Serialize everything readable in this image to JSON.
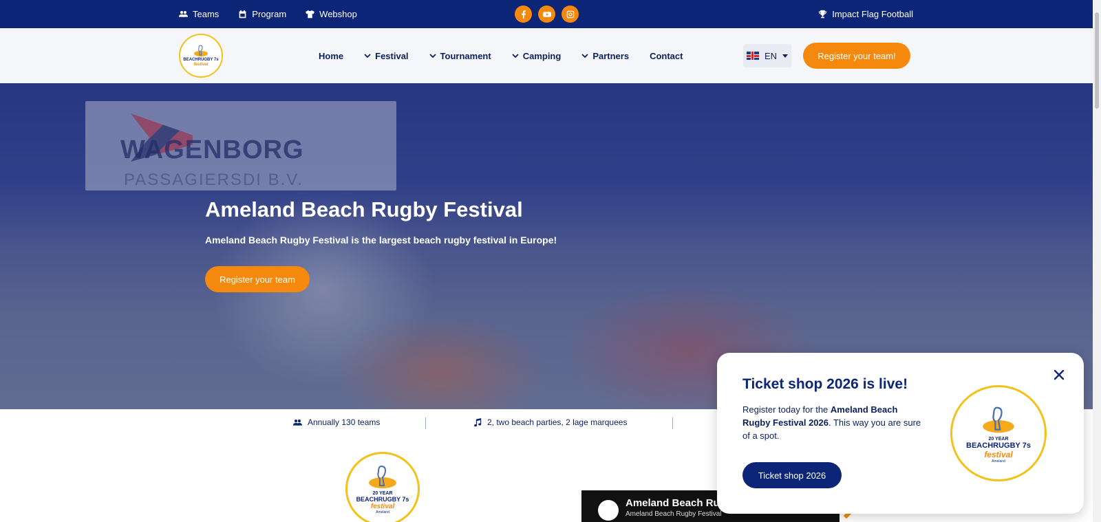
{
  "topbar": {
    "links": [
      {
        "label": "Teams",
        "icon": "users-icon"
      },
      {
        "label": "Program",
        "icon": "calendar-icon"
      },
      {
        "label": "Webshop",
        "icon": "tshirt-icon"
      }
    ],
    "socials": [
      "facebook-icon",
      "youtube-icon",
      "instagram-icon"
    ],
    "right_link": "Impact Flag Football"
  },
  "header": {
    "logo": {
      "line1": "BEACHRUGBY 7s",
      "line2": "festival"
    },
    "nav": [
      {
        "label": "Home",
        "dropdown": false
      },
      {
        "label": "Festival",
        "dropdown": true
      },
      {
        "label": "Tournament",
        "dropdown": true
      },
      {
        "label": "Camping",
        "dropdown": true
      },
      {
        "label": "Partners",
        "dropdown": true
      },
      {
        "label": "Contact",
        "dropdown": false
      }
    ],
    "language": "EN",
    "register_button": "Register your team!"
  },
  "hero": {
    "banner_line1": "WAGENBORG",
    "banner_line2": "PASSAGIERSDI     B.V.",
    "title": "Ameland Beach Rugby Festival",
    "subtitle": "Ameland Beach Rugby Festival is the largest beach rugby festival in Europe!",
    "button": "Register your team"
  },
  "stats": [
    {
      "label": "Annually 130 teams",
      "icon": "users-icon"
    },
    {
      "label": "2, two beach parties, 2 lage marquees",
      "icon": "music-icon"
    }
  ],
  "logo_big": {
    "year": "20 YEAR",
    "name": "BEACHRUGBY 7s",
    "fest": "festival",
    "sub": "Ameland"
  },
  "video": {
    "title": "Ameland Beach Rug",
    "channel": "Ameland Beach Rugby Festival"
  },
  "popup": {
    "title": "Ticket shop 2026 is live!",
    "text_prefix": "Register today for the ",
    "text_bold": "Ameland Beach Rugby Festival 2026",
    "text_suffix": ". This way you are sure of a spot.",
    "button": "Ticket shop 2026",
    "logo": {
      "year": "20 YEAR",
      "name": "BEACHRUGBY 7s",
      "fest": "festival",
      "sub": "Ameland"
    }
  },
  "colors": {
    "navy": "#0d2577",
    "orange": "#f5890d",
    "yellow": "#f2c21b"
  }
}
